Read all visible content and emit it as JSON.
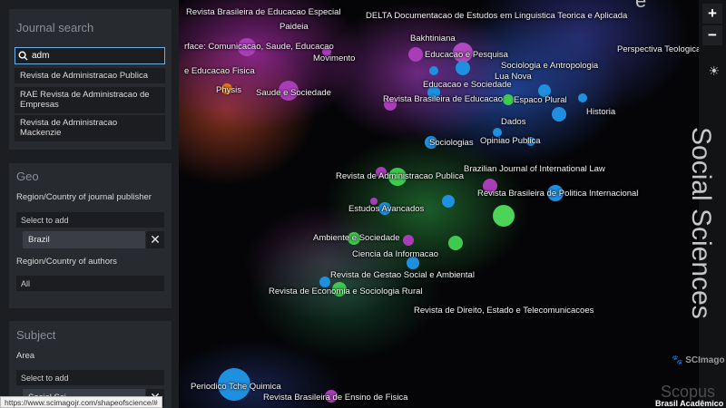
{
  "sidebar": {
    "journal_search": {
      "title": "Journal search",
      "query": "adm",
      "suggestions": [
        "Revista de Administracao Publica",
        "RAE Revista de Administracao de Empresas",
        "Revista de Administracao Mackenzie"
      ]
    },
    "geo": {
      "title": "Geo",
      "publisher_label": "Region/Country of journal publisher",
      "publisher_select": "Select to add",
      "publisher_tag": "Brazil",
      "authors_label": "Region/Country of authors",
      "authors_value": "All"
    },
    "subject": {
      "title": "Subject",
      "area_label": "Area",
      "area_select": "Select to add",
      "area_tag": "Social Sci"
    }
  },
  "map": {
    "area_title": "Social Sciences",
    "zoom_in": "+",
    "zoom_out": "−",
    "theme_icon": "sun-icon",
    "brand": "SCImago",
    "scopus": "Scopus",
    "country_badge": "Brasil Acadêmico",
    "top_edge_text": "e",
    "labels": [
      "Revista Brasileira de Educacao Especial",
      "DELTA Documentacao de Estudos em Linguistica Teorica e Aplicada",
      "Paideia",
      "Bakhtiniana",
      "rface: Comunicacao, Saude, Educacao",
      "Movimento",
      "Educacao e Pesquisa",
      "Perspectiva Teologica",
      "Sociologia e Antropologia",
      "Lua Nova",
      "e Educacao Fisica",
      "Physis",
      "Saude e Sociedade",
      "Educacao e Sociedade",
      "Revista Brasileira de Educacao",
      "Espaco Plural",
      "Historia",
      "Dados",
      "Sociologias",
      "Opiniao Publica",
      "Brazilian Journal of International Law",
      "Revista de Administracao Publica",
      "Revista Brasileira de Politica Internacional",
      "Estudos Avancados",
      "Ambiente e Sociedade",
      "Ciencia da Informacao",
      "Revista de Gestao Social e Ambiental",
      "Revista de Economia e Sociologia Rural",
      "Revista de Direito, Estado e Telecomunicacoes",
      "Periodico Tche Quimica",
      "Revista Brasileira de Ensino de Fisica"
    ]
  },
  "colors": {
    "purple": "#b04ac0",
    "blue": "#1f8fe0",
    "green": "#3fc94f",
    "orange": "#e07a1a",
    "focus": "#6ab0e8"
  },
  "browser": {
    "status_url": "https://www.scimagojr.com/shapeofscience/#"
  }
}
